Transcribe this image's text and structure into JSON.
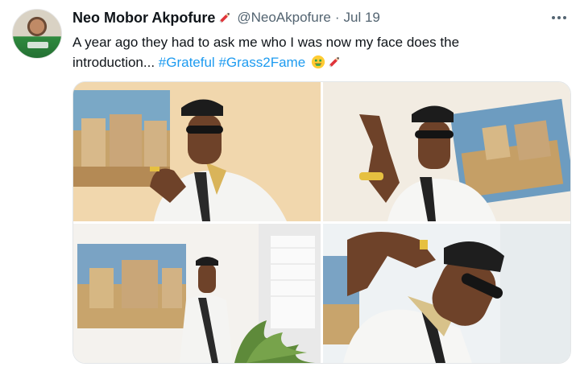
{
  "tweet": {
    "display_name": "Neo Mobor Akpofure",
    "handle": "@NeoAkpofure",
    "separator": "·",
    "date": "Jul 19",
    "text_line1": "A year ago they had to ask me who I was now my face does the",
    "text_line2_prefix": "introduction... ",
    "hashtag1": "#Grateful",
    "hashtag2": "#Grass2Fame",
    "emojis": [
      "money-mouth-face",
      "pencil"
    ]
  },
  "colors": {
    "accent": "#1d9bf0",
    "text_primary": "#0f1419",
    "text_secondary": "#536471"
  },
  "icons": {
    "name_badge": "pencil-icon",
    "more": "more-options-icon"
  }
}
